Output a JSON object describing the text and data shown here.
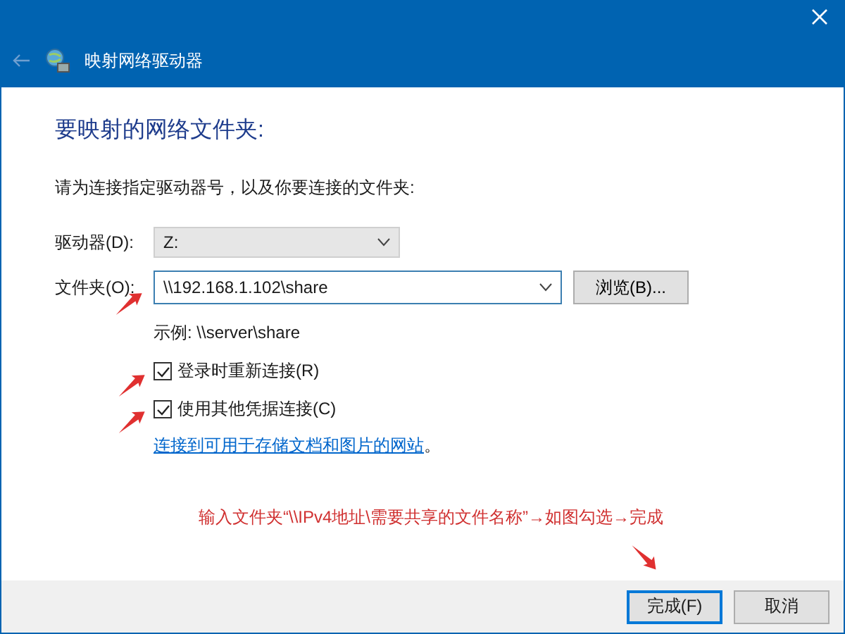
{
  "window": {
    "title": "映射网络驱动器"
  },
  "heading": "要映射的网络文件夹:",
  "instruction": "请为连接指定驱动器号，以及你要连接的文件夹:",
  "drive": {
    "label": "驱动器(D):",
    "value": "Z:"
  },
  "folder": {
    "label": "文件夹(O):",
    "value": "\\\\192.168.1.102\\share"
  },
  "browse_button": "浏览(B)...",
  "example": "示例: \\\\server\\share",
  "options": [
    {
      "label": "登录时重新连接(R)",
      "checked": true
    },
    {
      "label": "使用其他凭据连接(C)",
      "checked": true
    }
  ],
  "link": {
    "text": "连接到可用于存储文档和图片的网站",
    "suffix": "。"
  },
  "annotation": "输入文件夹“\\\\IPv4地址\\需要共享的文件名称”→如图勾选→完成",
  "buttons": [
    {
      "label": "完成(F)",
      "default": true
    },
    {
      "label": "取消",
      "default": false
    }
  ]
}
